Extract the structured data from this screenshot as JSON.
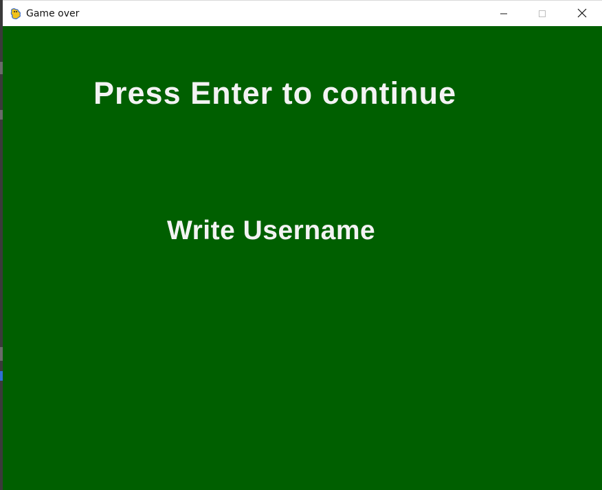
{
  "window": {
    "title": "Game over",
    "icon": "pygame-snake-icon",
    "controls": {
      "minimize_icon": "minimize-icon",
      "maximize_icon": "maximize-icon",
      "close_icon": "close-icon"
    }
  },
  "game": {
    "background_color": "#005f00",
    "text_color": "#f3f3f3",
    "headline": "Press Enter to continue",
    "prompt": "Write Username"
  }
}
